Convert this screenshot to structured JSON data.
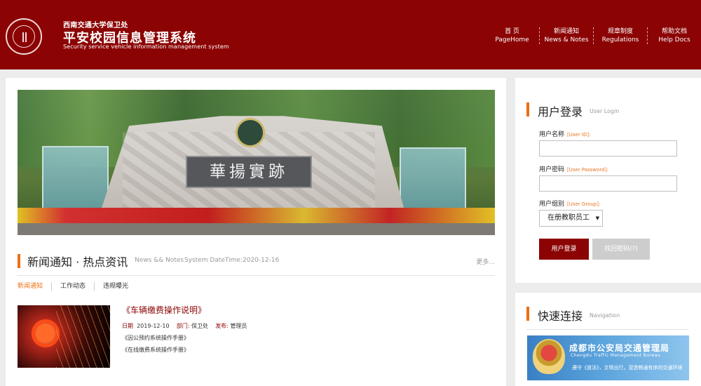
{
  "header": {
    "org": "西南交通大学保卫处",
    "title": "平安校园信息管理系统",
    "subtitle": "Security service vehicle information management system"
  },
  "nav": [
    {
      "zh": "首 页",
      "en": "PageHome"
    },
    {
      "zh": "新闻通知",
      "en": "News & Notes"
    },
    {
      "zh": "规章制度",
      "en": "Regulations"
    },
    {
      "zh": "帮助文档",
      "en": "Help Docs"
    }
  ],
  "banner": {
    "plaque_text": "華揚實跡"
  },
  "news": {
    "title": "新闻通知 · 热点资讯",
    "title_en": "News && Notes",
    "system_date": "System DateTime:2020-12-16",
    "more": "更多...",
    "tabs": [
      "新闻通知",
      "工作动态",
      "违规曝光"
    ],
    "item": {
      "title": "《车辆缴费操作说明》",
      "date_label": "日期",
      "date": "2019-12-10",
      "dept_label": "部门:",
      "dept": "保卫处",
      "pub_label": "发布:",
      "publisher": "管理员",
      "links": [
        "《因公预约系统操作手册》",
        "《在线缴费系统操作手册》"
      ]
    }
  },
  "login": {
    "title": "用户登录",
    "title_en": "User Login",
    "user_label": "用户名称",
    "user_hint": "[User ID]:",
    "user_value": "",
    "pass_label": "用户密码",
    "pass_hint": "[User Password]:",
    "pass_value": "",
    "group_label": "用户组别",
    "group_hint": "[User Group]:",
    "group_value": "在册教职员工",
    "login_button": "用户登录",
    "find_button": "找回密码(?)"
  },
  "quick": {
    "title": "快速连接",
    "title_en": "Navigation",
    "link_name": "成都市公安局交通管理局",
    "link_pinyin": "Chengdu Traffic Management Bureau",
    "link_slogan": "遵守《道法》，文明出行，营造畅通有序的交通环境"
  },
  "colors": {
    "brand": "#8b0303",
    "accent": "#ec7016"
  }
}
